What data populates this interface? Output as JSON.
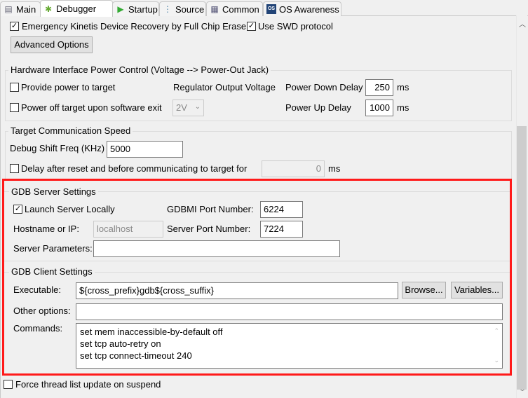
{
  "tabs": [
    {
      "label": "Main",
      "icon": "document-icon"
    },
    {
      "label": "Debugger",
      "icon": "bug-icon",
      "active": true
    },
    {
      "label": "Startup",
      "icon": "play-icon"
    },
    {
      "label": "Source",
      "icon": "source-tree-icon"
    },
    {
      "label": "Common",
      "icon": "table-icon"
    },
    {
      "label": "OS Awareness",
      "icon": "os-icon"
    }
  ],
  "top": {
    "emergency_label": "Emergency Kinetis Device Recovery by Full Chip Erase",
    "emergency_checked": true,
    "swd_label": "Use SWD protocol",
    "swd_checked": true,
    "advanced_button": "Advanced Options"
  },
  "power": {
    "title": "Hardware Interface Power Control (Voltage --> Power-Out Jack)",
    "provide_label": "Provide power to target",
    "poweroff_label": "Power off target upon software exit",
    "regulator_label": "Regulator Output Voltage",
    "voltage_value": "2V",
    "down_label": "Power Down Delay",
    "down_value": "250",
    "up_label": "Power Up Delay",
    "up_value": "1000",
    "unit": "ms"
  },
  "speed": {
    "title": "Target Communication Speed",
    "freq_label": "Debug Shift Freq (KHz)",
    "freq_value": "5000",
    "delay_label": "Delay after reset and before communicating to target for",
    "delay_value": "0",
    "unit": "ms"
  },
  "server": {
    "title": "GDB Server Settings",
    "launch_label": "Launch Server Locally",
    "launch_checked": true,
    "gdbmi_label": "GDBMI Port Number:",
    "gdbmi_value": "6224",
    "host_label": "Hostname or IP:",
    "host_value": "localhost",
    "port_label": "Server Port Number:",
    "port_value": "7224",
    "params_label": "Server Parameters:",
    "params_value": ""
  },
  "client": {
    "title": "GDB Client Settings",
    "exe_label": "Executable:",
    "exe_value": "${cross_prefix}gdb${cross_suffix}",
    "browse_button": "Browse...",
    "variables_button": "Variables...",
    "other_label": "Other options:",
    "other_value": "",
    "commands_label": "Commands:",
    "commands": [
      "set mem inaccessible-by-default off",
      "set tcp auto-retry on",
      "set tcp connect-timeout 240"
    ]
  },
  "force": {
    "label": "Force thread list update on suspend",
    "checked": false
  },
  "colors": {
    "highlight": "#ff1a1a"
  }
}
